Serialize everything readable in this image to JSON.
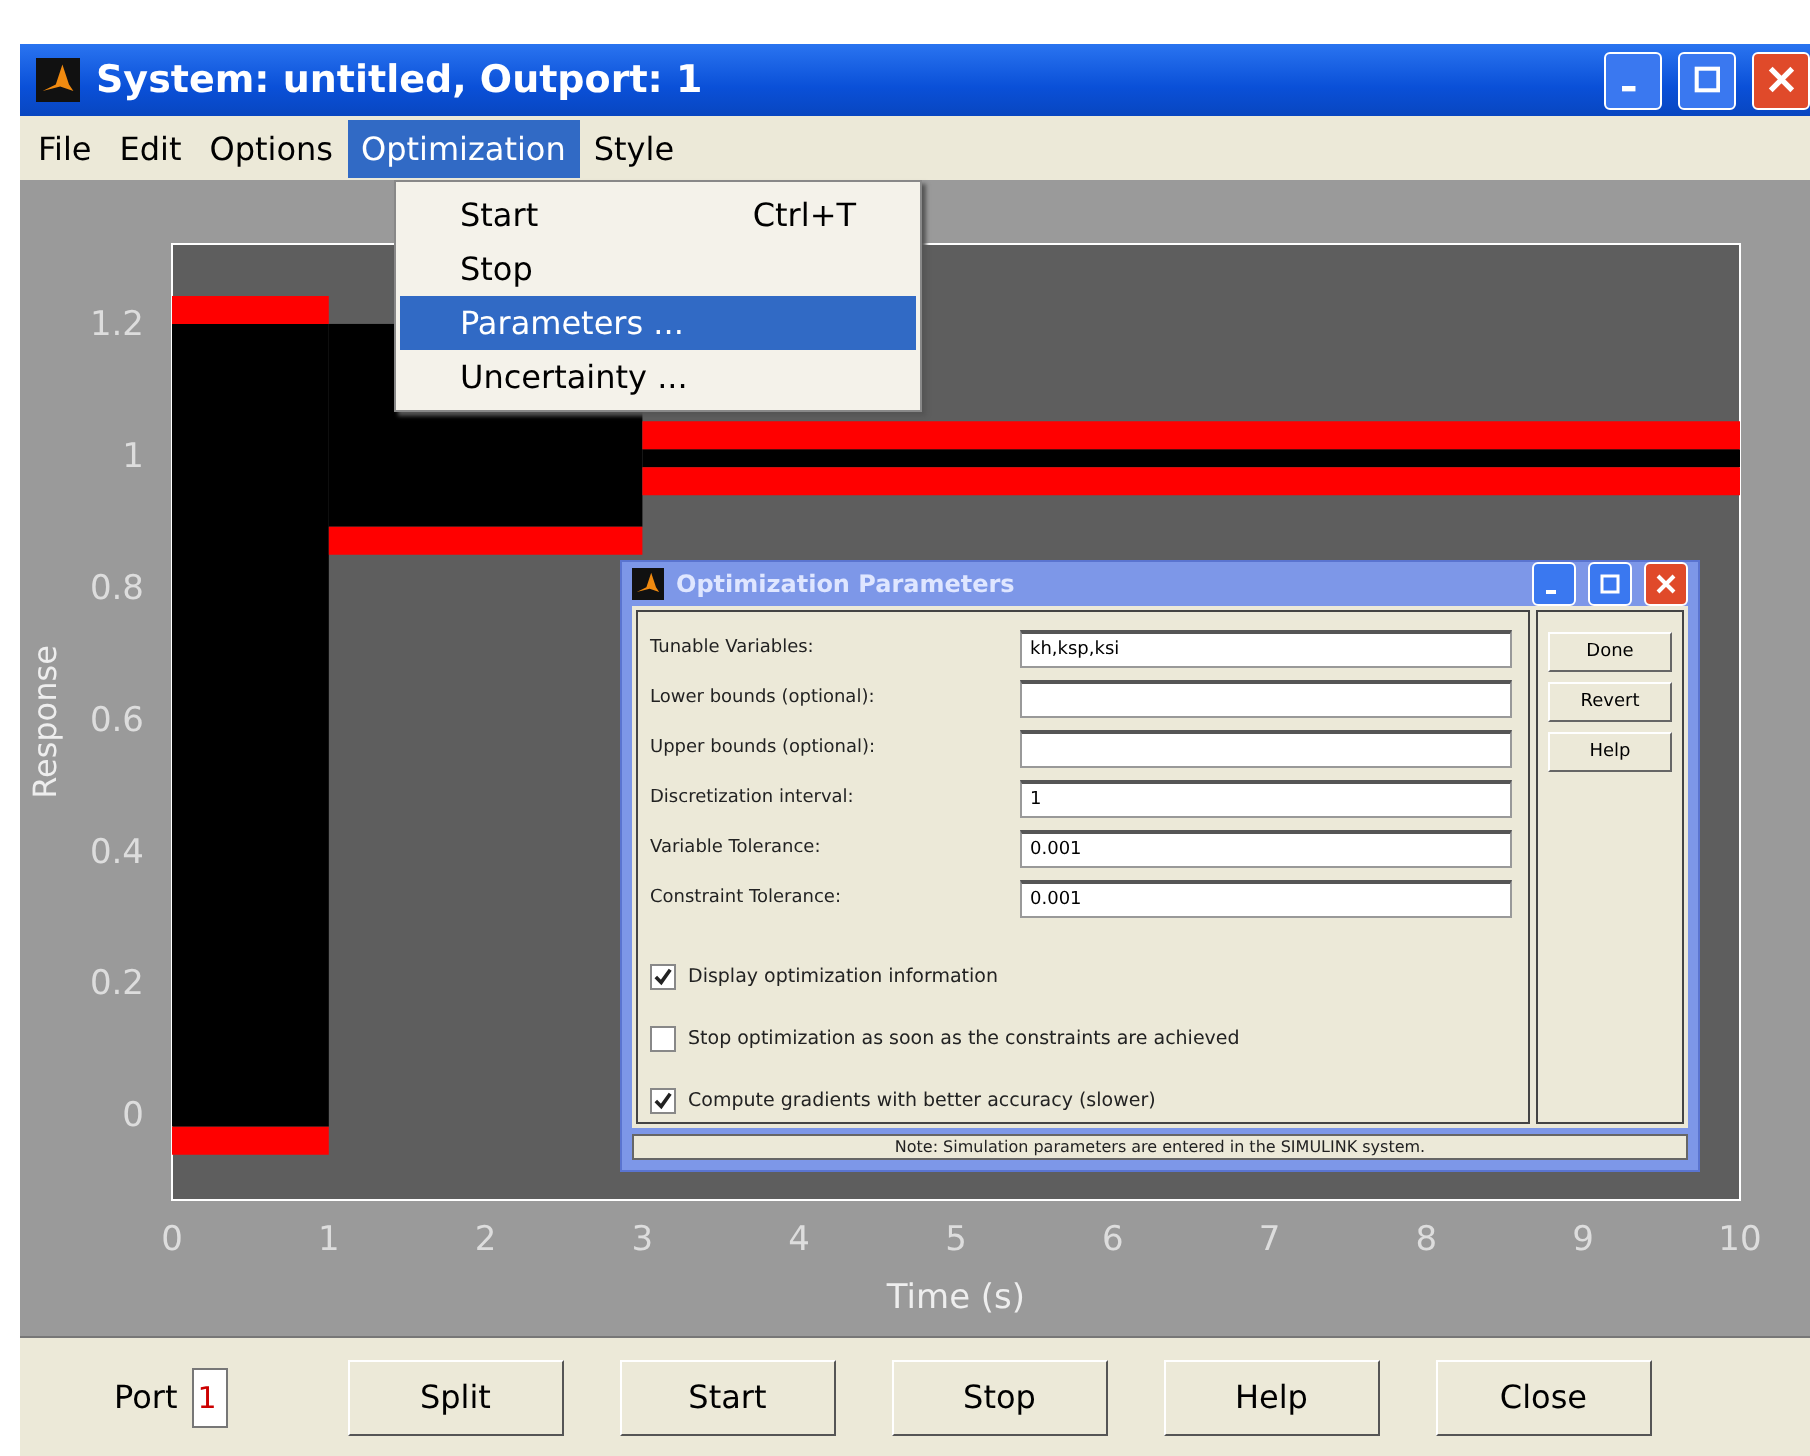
{
  "window": {
    "title": "System: untitled, Outport: 1"
  },
  "menu_bar": [
    {
      "label": "File",
      "selected": false
    },
    {
      "label": "Edit",
      "selected": false
    },
    {
      "label": "Options",
      "selected": false
    },
    {
      "label": "Optimization",
      "selected": true
    },
    {
      "label": "Style",
      "selected": false
    }
  ],
  "open_menu": {
    "items": [
      {
        "label": "Start",
        "shortcut": "Ctrl+T",
        "selected": false
      },
      {
        "label": "Stop",
        "selected": false
      },
      {
        "label": "Parameters ...",
        "selected": true
      },
      {
        "label": "Uncertainty ...",
        "selected": false
      }
    ]
  },
  "chart": {
    "chart_data": {
      "type": "line",
      "xlabel": "Time (s)",
      "ylabel": "Response",
      "x": [
        0,
        1,
        1,
        3,
        3,
        10
      ],
      "xlim": [
        0,
        10
      ],
      "ylim": [
        -0.13,
        1.32
      ],
      "series": [
        {
          "color": "#ff0000",
          "values": [
            1.22,
            1.22,
            null,
            null,
            1.03,
            1.03
          ]
        },
        {
          "color": "#ff0000",
          "values": [
            -0.04,
            -0.04,
            0.87,
            0.87,
            0.96,
            0.96
          ]
        }
      ],
      "xticks": [
        0,
        1,
        2,
        3,
        4,
        5,
        6,
        7,
        8,
        9,
        10
      ],
      "yticks": [
        0,
        0.2,
        0.4,
        0.6,
        0.8,
        {
          "value": 1,
          "label": "1"
        },
        1.2
      ]
    }
  },
  "dialog": {
    "title": "Optimization Parameters",
    "fields": [
      {
        "label": "Tunable Variables:",
        "value": "kh,ksp,ksi"
      },
      {
        "label": "Lower bounds (optional):"
      },
      {
        "label": "Upper bounds (optional):"
      },
      {
        "label": "Discretization interval:",
        "value": "1"
      },
      {
        "label": "Variable Tolerance:",
        "value": "0.001"
      },
      {
        "label": "Constraint Tolerance:",
        "value": "0.001"
      }
    ],
    "checkboxes": [
      {
        "label": "Display optimization information",
        "checked": true
      },
      {
        "label": "Stop optimization as soon as the constraints are achieved",
        "checked": false
      },
      {
        "label": "Compute gradients with better accuracy (slower)",
        "checked": true
      }
    ],
    "buttons": [
      "Done",
      "Revert",
      "Help"
    ],
    "note": "Note: Simulation parameters are entered in the SIMULINK system."
  },
  "bottom_bar": {
    "port_label": "Port",
    "port_value": "1",
    "buttons": [
      "Split",
      "Start",
      "Stop",
      "Help",
      "Close"
    ]
  }
}
